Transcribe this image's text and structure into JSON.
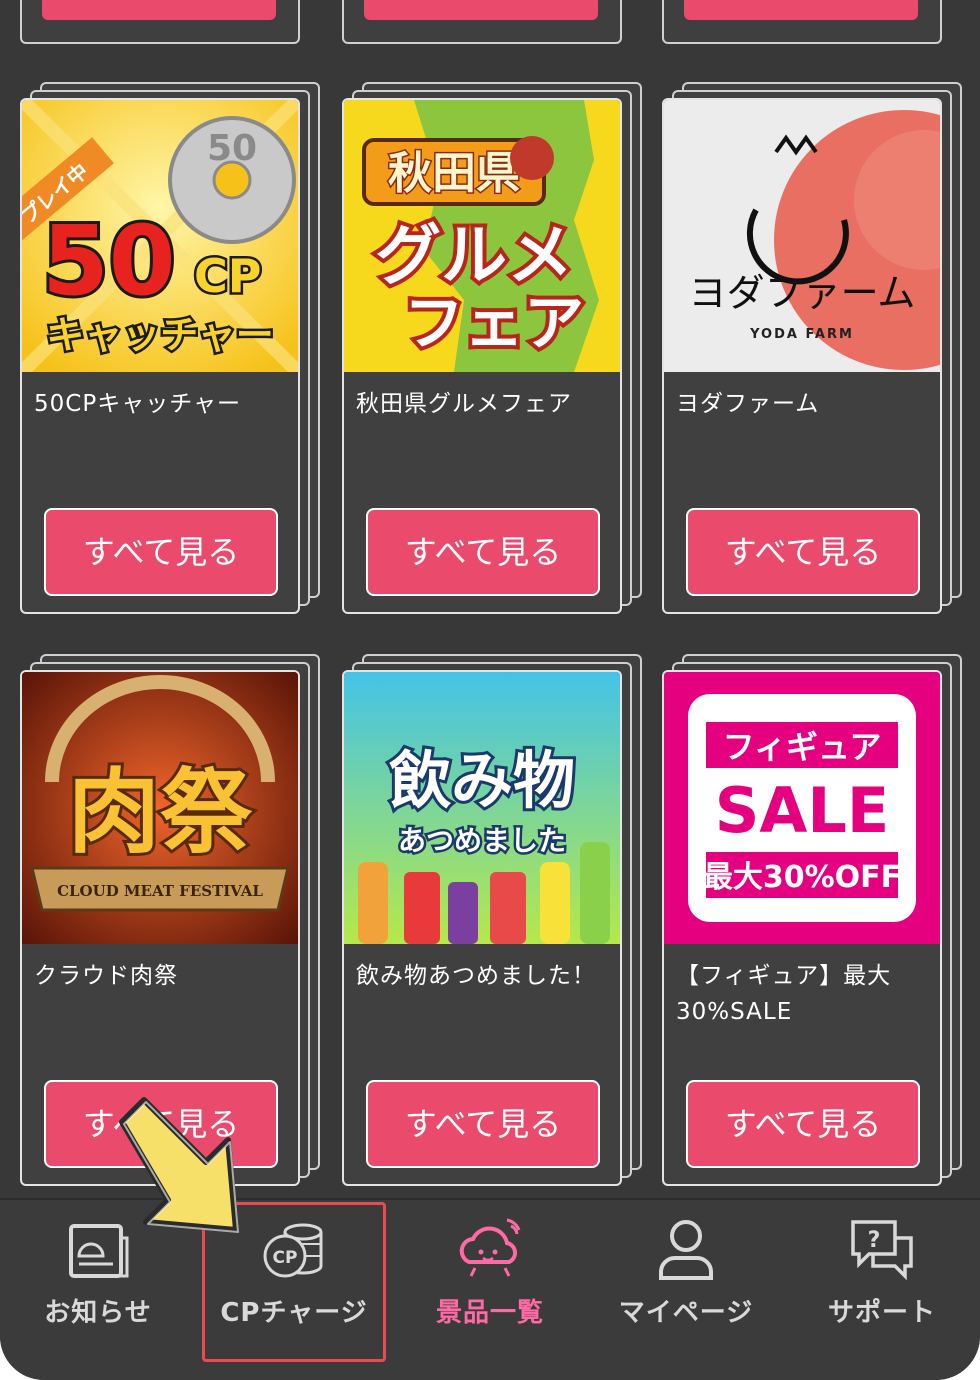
{
  "cards": [
    {
      "title": "50CPキャッチャー",
      "button": "すべて見る",
      "art": {
        "badge": "プレイ中",
        "big": "50",
        "cp": "CP",
        "sub": "キャッチャー",
        "coin": "50"
      }
    },
    {
      "title": "秋田県グルメフェア",
      "button": "すべて見る",
      "art": {
        "top": "秋田県",
        "line1": "グルメ",
        "line2": "フェア"
      }
    },
    {
      "title": "ヨダファーム",
      "button": "すべて見る",
      "art": {
        "logo": "ヨダファーム",
        "sub": "YODA FARM"
      }
    },
    {
      "title": "クラウド肉祭",
      "button": "すべて見る",
      "art": {
        "big": "肉祭",
        "ribbon": "CLOUD MEAT FESTIVAL"
      }
    },
    {
      "title": "飲み物あつめました！",
      "button": "すべて見る",
      "art": {
        "big": "飲み物",
        "sub": "あつめました"
      }
    },
    {
      "title": "【フィギュア】最大30%SALE",
      "button": "すべて見る",
      "art": {
        "top": "フィギュア",
        "mid": "SALE",
        "bottom": "最大30%OFF"
      }
    }
  ],
  "nav": [
    {
      "label": "お知らせ",
      "icon": "news-icon"
    },
    {
      "label": "CPチャージ",
      "icon": "cp-coin-icon"
    },
    {
      "label": "景品一覧",
      "icon": "cloud-prize-icon",
      "active": true
    },
    {
      "label": "マイページ",
      "icon": "user-icon"
    },
    {
      "label": "サポート",
      "icon": "support-chat-icon"
    }
  ],
  "colors": {
    "accent": "#ea4a6c",
    "active_nav": "#ff6aa6",
    "background": "#383838",
    "highlight": "#e94c50",
    "arrow": "#f7e06a"
  }
}
